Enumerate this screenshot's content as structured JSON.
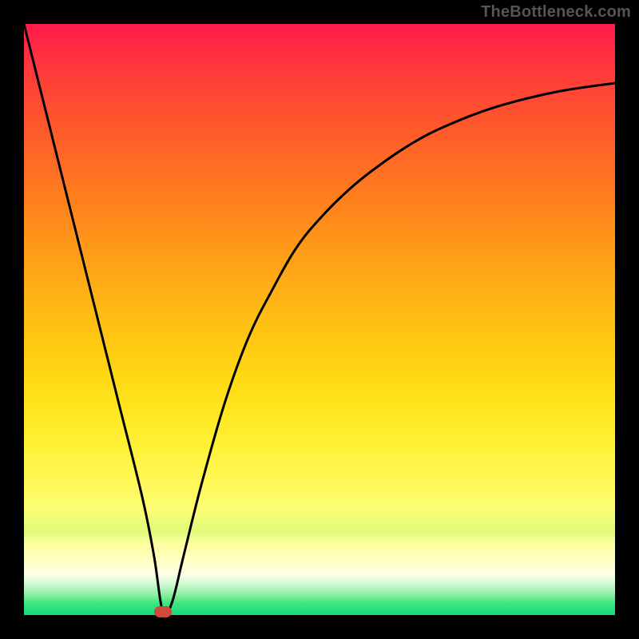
{
  "watermark": "TheBottleneck.com",
  "colors": {
    "background": "#000000",
    "curve": "#000000",
    "marker": "#d24a3a"
  },
  "chart_data": {
    "type": "line",
    "title": "",
    "xlabel": "",
    "ylabel": "",
    "xlim": [
      0,
      100
    ],
    "ylim": [
      0,
      100
    ],
    "grid": false,
    "legend": false,
    "series": [
      {
        "name": "bottleneck-curve",
        "x": [
          0,
          4,
          8,
          12,
          16,
          20,
          22,
          23.5,
          25,
          27,
          30,
          34,
          38,
          42,
          46,
          50,
          55,
          60,
          66,
          72,
          80,
          90,
          100
        ],
        "y": [
          100,
          84,
          68,
          52,
          36,
          20,
          10,
          0.5,
          2,
          10,
          22,
          36,
          47,
          55,
          62,
          67,
          72,
          76,
          80,
          83,
          86,
          88.5,
          90
        ]
      }
    ],
    "marker": {
      "x": 23.5,
      "y": 0.5
    },
    "gradient_stops": [
      {
        "pct": 0,
        "color": "#ff1a4c"
      },
      {
        "pct": 50,
        "color": "#ffd312"
      },
      {
        "pct": 78,
        "color": "#fff85a"
      },
      {
        "pct": 100,
        "color": "#15db7a"
      }
    ]
  }
}
